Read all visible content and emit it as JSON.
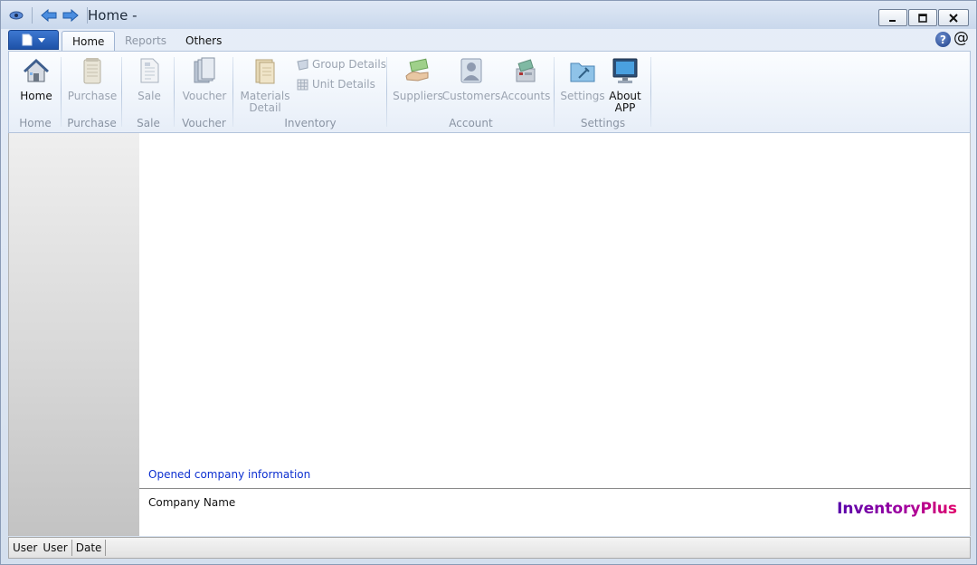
{
  "window": {
    "title": "Home -"
  },
  "tabs": [
    {
      "label": "Home",
      "state": "active"
    },
    {
      "label": "Reports",
      "state": "disabled"
    },
    {
      "label": "Others",
      "state": "normal"
    }
  ],
  "help_symbol": "?",
  "at_symbol": "@",
  "ribbon": {
    "groups": {
      "home": {
        "label": "Home",
        "button": "Home"
      },
      "purchase": {
        "label": "Purchase",
        "button": "Purchase"
      },
      "sale": {
        "label": "Sale",
        "button": "Sale"
      },
      "voucher": {
        "label": "Voucher",
        "button": "Voucher"
      },
      "inventory": {
        "label": "Inventory",
        "materials_line1": "Materials",
        "materials_line2": "Detail",
        "group_details": "Group Details",
        "unit_details": "Unit Details"
      },
      "account": {
        "label": "Account",
        "suppliers": "Suppliers",
        "customers": "Customers",
        "accounts": "Accounts"
      },
      "settings": {
        "label": "Settings",
        "settings": "Settings",
        "about_line1": "About",
        "about_line2": "APP"
      }
    }
  },
  "main": {
    "company_info_link": "Opened company information",
    "company_name_label": "Company Name",
    "brand": "InventoryPlus"
  },
  "statusbar": {
    "user_label": "User",
    "user_value": "User",
    "date_label": "Date"
  },
  "colors": {
    "accent_blue": "#1e52a8",
    "link": "#0c2fd0",
    "brand_start": "#5500aa",
    "brand_end": "#e0006a"
  }
}
